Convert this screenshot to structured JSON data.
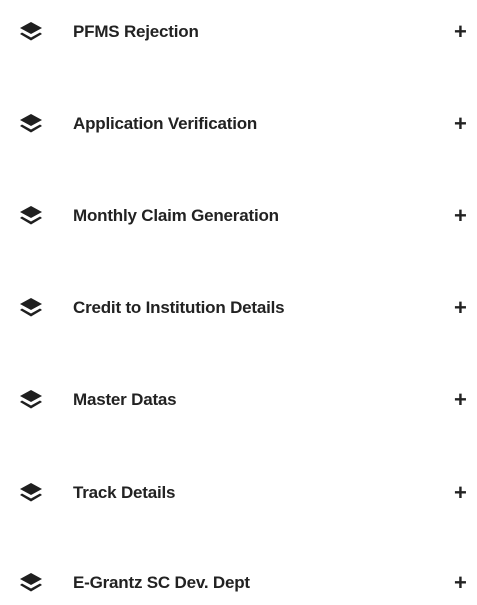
{
  "menu": {
    "items": [
      {
        "label": "PFMS Rejection",
        "icon": "layers-icon",
        "expand": "+"
      },
      {
        "label": "Application Verification",
        "icon": "layers-icon",
        "expand": "+"
      },
      {
        "label": "Monthly Claim Generation",
        "icon": "layers-icon",
        "expand": "+"
      },
      {
        "label": "Credit to Institution Details",
        "icon": "layers-icon",
        "expand": "+"
      },
      {
        "label": "Master Datas",
        "icon": "layers-icon",
        "expand": "+"
      },
      {
        "label": "Track Details",
        "icon": "layers-icon",
        "expand": "+"
      },
      {
        "label": "E-Grantz SC Dev. Dept",
        "icon": "layers-icon",
        "expand": "+"
      }
    ]
  }
}
